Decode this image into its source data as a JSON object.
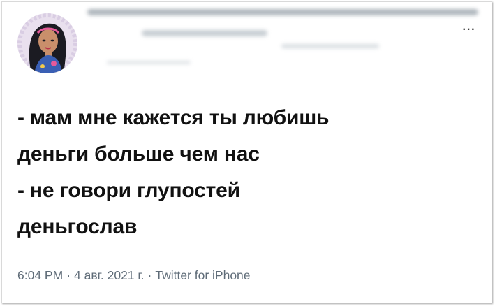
{
  "tweet": {
    "more_label": "···",
    "lines": [
      "- мам мне кажется ты любишь",
      "деньги больше чем нас",
      "- не говори глупостей",
      "деньгослав"
    ],
    "time": "6:04 PM",
    "date": "4 авг. 2021 г.",
    "source": "Twitter for iPhone",
    "separator": "·"
  },
  "colors": {
    "text": "#111111",
    "meta": "#5f6c78",
    "avatar_bg": "#e8dfee"
  }
}
